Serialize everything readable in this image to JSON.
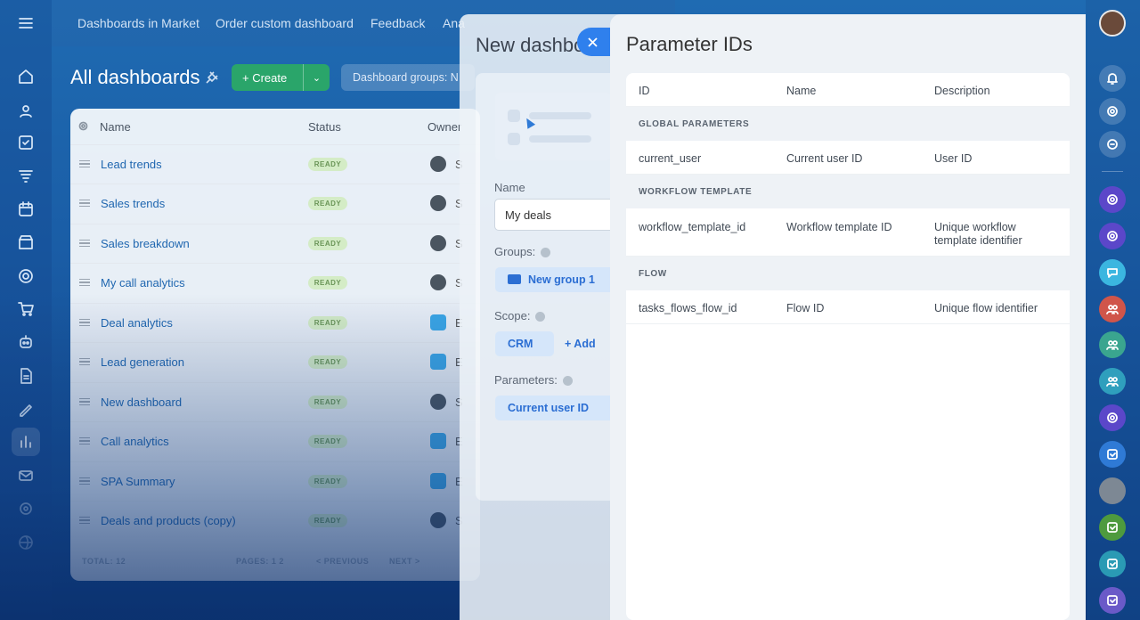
{
  "topnav": [
    "Dashboards in Market",
    "Order custom dashboard",
    "Feedback",
    "Ana"
  ],
  "page": {
    "title": "All dashboards"
  },
  "toolbar": {
    "create_label": "+ Create",
    "filter_placeholder": "Dashboard groups: N"
  },
  "table": {
    "headers": {
      "name": "Name",
      "status": "Status",
      "owner": "Owner"
    },
    "rows": [
      {
        "name": "Lead trends",
        "status": "READY",
        "owner": "S"
      },
      {
        "name": "Sales trends",
        "status": "READY",
        "owner": "S"
      },
      {
        "name": "Sales breakdown",
        "status": "READY",
        "owner": "S"
      },
      {
        "name": "My call analytics",
        "status": "READY",
        "owner": "S"
      },
      {
        "name": "Deal analytics",
        "status": "READY",
        "owner": "E"
      },
      {
        "name": "Lead generation",
        "status": "READY",
        "owner": "E"
      },
      {
        "name": "New dashboard",
        "status": "READY",
        "owner": "S"
      },
      {
        "name": "Call analytics",
        "status": "READY",
        "owner": "E"
      },
      {
        "name": "SPA Summary",
        "status": "READY",
        "owner": "E"
      },
      {
        "name": "Deals and products (copy)",
        "status": "READY",
        "owner": "S"
      }
    ],
    "footer": {
      "total": "TOTAL: 12",
      "pages": "PAGES: 1 2",
      "prev": "< PREVIOUS",
      "next": "NEXT >"
    }
  },
  "new_dashboard": {
    "title": "New dashbo",
    "name_label": "Name",
    "name_value": "My deals",
    "groups_label": "Groups:",
    "group_chip": "New group 1",
    "scope_label": "Scope:",
    "scope_chip": "CRM",
    "scope_add": "+ Add",
    "params_label": "Parameters:",
    "param_chip": "Current user ID"
  },
  "panel": {
    "title": "Parameter IDs",
    "headers": {
      "id": "ID",
      "name": "Name",
      "description": "Description"
    },
    "sections": [
      {
        "title": "GLOBAL PARAMETERS",
        "rows": [
          {
            "id": "current_user",
            "name": "Current user ID",
            "description": "User ID"
          }
        ]
      },
      {
        "title": "WORKFLOW TEMPLATE",
        "rows": [
          {
            "id": "workflow_template_id",
            "name": "Workflow template ID",
            "description": "Unique workflow template identifier"
          }
        ]
      },
      {
        "title": "FLOW",
        "rows": [
          {
            "id": "tasks_flows_flow_id",
            "name": "Flow ID",
            "description": "Unique flow identifier"
          }
        ]
      }
    ]
  },
  "colors": {
    "accent": "#2f80ed",
    "create": "#2aa56a",
    "ready_badge": "#d4ecc6"
  }
}
